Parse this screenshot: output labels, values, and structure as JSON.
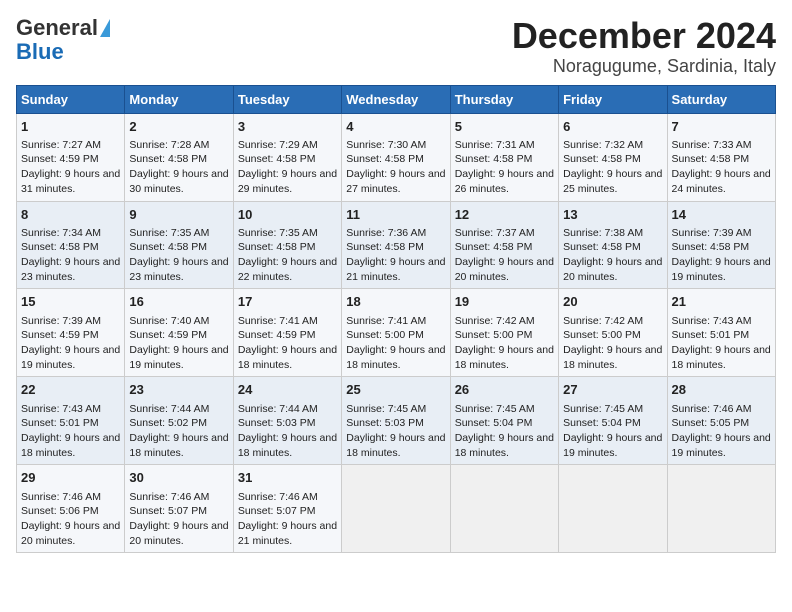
{
  "logo": {
    "line1": "General",
    "line2": "Blue"
  },
  "title": "December 2024",
  "subtitle": "Noragugume, Sardinia, Italy",
  "days_of_week": [
    "Sunday",
    "Monday",
    "Tuesday",
    "Wednesday",
    "Thursday",
    "Friday",
    "Saturday"
  ],
  "weeks": [
    [
      {
        "day": 1,
        "sunrise": "7:27 AM",
        "sunset": "4:59 PM",
        "daylight": "9 hours and 31 minutes."
      },
      {
        "day": 2,
        "sunrise": "7:28 AM",
        "sunset": "4:58 PM",
        "daylight": "9 hours and 30 minutes."
      },
      {
        "day": 3,
        "sunrise": "7:29 AM",
        "sunset": "4:58 PM",
        "daylight": "9 hours and 29 minutes."
      },
      {
        "day": 4,
        "sunrise": "7:30 AM",
        "sunset": "4:58 PM",
        "daylight": "9 hours and 27 minutes."
      },
      {
        "day": 5,
        "sunrise": "7:31 AM",
        "sunset": "4:58 PM",
        "daylight": "9 hours and 26 minutes."
      },
      {
        "day": 6,
        "sunrise": "7:32 AM",
        "sunset": "4:58 PM",
        "daylight": "9 hours and 25 minutes."
      },
      {
        "day": 7,
        "sunrise": "7:33 AM",
        "sunset": "4:58 PM",
        "daylight": "9 hours and 24 minutes."
      }
    ],
    [
      {
        "day": 8,
        "sunrise": "7:34 AM",
        "sunset": "4:58 PM",
        "daylight": "9 hours and 23 minutes."
      },
      {
        "day": 9,
        "sunrise": "7:35 AM",
        "sunset": "4:58 PM",
        "daylight": "9 hours and 23 minutes."
      },
      {
        "day": 10,
        "sunrise": "7:35 AM",
        "sunset": "4:58 PM",
        "daylight": "9 hours and 22 minutes."
      },
      {
        "day": 11,
        "sunrise": "7:36 AM",
        "sunset": "4:58 PM",
        "daylight": "9 hours and 21 minutes."
      },
      {
        "day": 12,
        "sunrise": "7:37 AM",
        "sunset": "4:58 PM",
        "daylight": "9 hours and 20 minutes."
      },
      {
        "day": 13,
        "sunrise": "7:38 AM",
        "sunset": "4:58 PM",
        "daylight": "9 hours and 20 minutes."
      },
      {
        "day": 14,
        "sunrise": "7:39 AM",
        "sunset": "4:58 PM",
        "daylight": "9 hours and 19 minutes."
      }
    ],
    [
      {
        "day": 15,
        "sunrise": "7:39 AM",
        "sunset": "4:59 PM",
        "daylight": "9 hours and 19 minutes."
      },
      {
        "day": 16,
        "sunrise": "7:40 AM",
        "sunset": "4:59 PM",
        "daylight": "9 hours and 19 minutes."
      },
      {
        "day": 17,
        "sunrise": "7:41 AM",
        "sunset": "4:59 PM",
        "daylight": "9 hours and 18 minutes."
      },
      {
        "day": 18,
        "sunrise": "7:41 AM",
        "sunset": "5:00 PM",
        "daylight": "9 hours and 18 minutes."
      },
      {
        "day": 19,
        "sunrise": "7:42 AM",
        "sunset": "5:00 PM",
        "daylight": "9 hours and 18 minutes."
      },
      {
        "day": 20,
        "sunrise": "7:42 AM",
        "sunset": "5:00 PM",
        "daylight": "9 hours and 18 minutes."
      },
      {
        "day": 21,
        "sunrise": "7:43 AM",
        "sunset": "5:01 PM",
        "daylight": "9 hours and 18 minutes."
      }
    ],
    [
      {
        "day": 22,
        "sunrise": "7:43 AM",
        "sunset": "5:01 PM",
        "daylight": "9 hours and 18 minutes."
      },
      {
        "day": 23,
        "sunrise": "7:44 AM",
        "sunset": "5:02 PM",
        "daylight": "9 hours and 18 minutes."
      },
      {
        "day": 24,
        "sunrise": "7:44 AM",
        "sunset": "5:03 PM",
        "daylight": "9 hours and 18 minutes."
      },
      {
        "day": 25,
        "sunrise": "7:45 AM",
        "sunset": "5:03 PM",
        "daylight": "9 hours and 18 minutes."
      },
      {
        "day": 26,
        "sunrise": "7:45 AM",
        "sunset": "5:04 PM",
        "daylight": "9 hours and 18 minutes."
      },
      {
        "day": 27,
        "sunrise": "7:45 AM",
        "sunset": "5:04 PM",
        "daylight": "9 hours and 19 minutes."
      },
      {
        "day": 28,
        "sunrise": "7:46 AM",
        "sunset": "5:05 PM",
        "daylight": "9 hours and 19 minutes."
      }
    ],
    [
      {
        "day": 29,
        "sunrise": "7:46 AM",
        "sunset": "5:06 PM",
        "daylight": "9 hours and 20 minutes."
      },
      {
        "day": 30,
        "sunrise": "7:46 AM",
        "sunset": "5:07 PM",
        "daylight": "9 hours and 20 minutes."
      },
      {
        "day": 31,
        "sunrise": "7:46 AM",
        "sunset": "5:07 PM",
        "daylight": "9 hours and 21 minutes."
      },
      null,
      null,
      null,
      null
    ]
  ],
  "labels": {
    "sunrise": "Sunrise:",
    "sunset": "Sunset:",
    "daylight": "Daylight:"
  }
}
